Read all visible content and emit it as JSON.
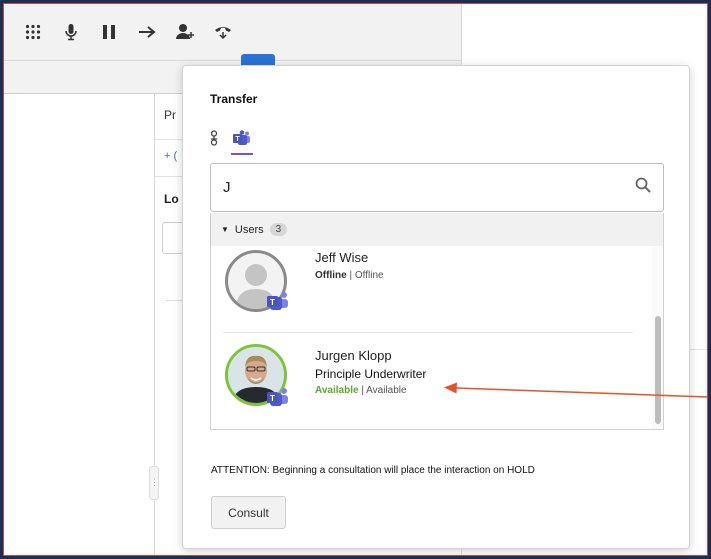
{
  "colors": {
    "accent_blue": "#2a72d8",
    "teams_purple": "#7b4fd6",
    "available_green": "#5aaa2a",
    "annotation_arrow": "#e4532c",
    "outer_background": "#1b2f52"
  },
  "toolbar": {
    "icons": [
      "dialpad-icon",
      "microphone-icon",
      "pause-icon",
      "arrow-right-icon",
      "add-user-icon",
      "hangup-icon"
    ]
  },
  "background_panel": {
    "pr_label": "Pr",
    "plus_label": "+ (",
    "lo_label": "Lo"
  },
  "transfer": {
    "title": "Transfer",
    "tabs": [
      {
        "icon": "directory-icon",
        "selected": false
      },
      {
        "icon": "teams-icon",
        "selected": true
      }
    ],
    "search": {
      "value": "J",
      "placeholder": ""
    },
    "users_group": {
      "label": "Users",
      "count": "3"
    },
    "users": [
      {
        "name": "Jeff Wise",
        "title": "",
        "state": "Offline",
        "separator": "|",
        "status_text": "Offline"
      },
      {
        "name": "Jurgen Klopp",
        "title": "Principle Underwriter",
        "state": "Available",
        "separator": "|",
        "status_text": "Available"
      }
    ],
    "attention_text": "ATTENTION: Beginning a consultation will place the interaction on HOLD",
    "consult_label": "Consult"
  }
}
